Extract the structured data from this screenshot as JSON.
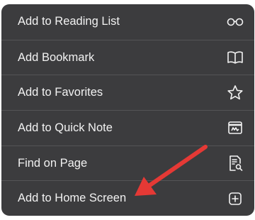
{
  "menu": {
    "items": [
      {
        "label": "Add to Reading List",
        "icon": "glasses-icon"
      },
      {
        "label": "Add Bookmark",
        "icon": "book-icon"
      },
      {
        "label": "Add to Favorites",
        "icon": "star-icon"
      },
      {
        "label": "Add to Quick Note",
        "icon": "quick-note-icon"
      },
      {
        "label": "Find on Page",
        "icon": "find-on-page-icon"
      },
      {
        "label": "Add to Home Screen",
        "icon": "plus-square-icon"
      }
    ]
  },
  "annotation": {
    "type": "arrow",
    "color": "#e53935",
    "points_to": "Add to Home Screen"
  },
  "colors": {
    "menu_bg": "#3c3c3e",
    "separator": "#545456",
    "text": "#f2f2f2"
  }
}
